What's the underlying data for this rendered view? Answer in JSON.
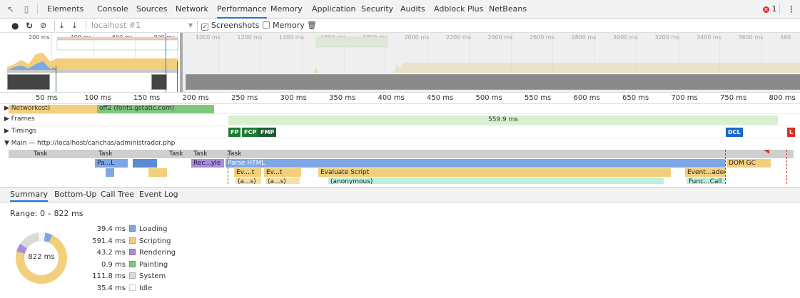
{
  "tabs": [
    "Elements",
    "Console",
    "Sources",
    "Network",
    "Performance",
    "Memory",
    "Application",
    "Security",
    "Audits",
    "Adblock Plus",
    "NetBeans"
  ],
  "active_tab": "Performance",
  "error_count": "1",
  "toolbar": {
    "recording_target": "localhost #1",
    "screenshots_label": "Screenshots",
    "memory_label": "Memory"
  },
  "overview_ticks": [
    "200 ms",
    "400 ms",
    "600 ms",
    "800 ms",
    "1000 ms",
    "1200 ms",
    "1400 ms",
    "1600 ms",
    "1800 ms",
    "2000 ms",
    "2200 ms",
    "2400 ms",
    "2600 ms",
    "2800 ms",
    "3000 ms",
    "3200 ms",
    "3400 ms",
    "3600 ms",
    "380"
  ],
  "ruler_ticks": [
    "50 ms",
    "100 ms",
    "150 ms",
    "200 ms",
    "250 ms",
    "300 ms",
    "350 ms",
    "400 ms",
    "450 ms",
    "500 ms",
    "550 ms",
    "600 ms",
    "650 ms",
    "700 ms",
    "750 ms",
    "800 ms"
  ],
  "tracks": {
    "network": {
      "label": "Network",
      "label_tail": "ost)",
      "request": "off2 (fonts.gstatic.com)"
    },
    "frames": {
      "label": "Frames",
      "frame_time": "559.9 ms"
    },
    "timings": {
      "label": "Timings",
      "fp": "FP",
      "fcp": "FCP",
      "fmp": "FMP",
      "dcl": "DCL",
      "l": "L"
    },
    "main": {
      "label": "Main — http://localhost/canchas/administrador.php"
    }
  },
  "flame": {
    "task": "Task",
    "parse_short": "Pa...L",
    "recalc_style": "Rec...yle",
    "parse_html": "Parse HTML",
    "dom_gc": "DOM GC",
    "ev_short": "Ev....t",
    "ev_short2": "Ev...t",
    "evaluate_script": "Evaluate Script",
    "event_loaded": "Event...aded",
    "anon_short": "(a...s)",
    "anon_short2": "(a...s)",
    "anonymous": "(anonymous)",
    "func_call": "Func...Call"
  },
  "bottom_tabs": [
    "Summary",
    "Bottom-Up",
    "Call Tree",
    "Event Log"
  ],
  "summary": {
    "range": "Range: 0 – 822 ms",
    "total": "822 ms",
    "items": [
      {
        "value": "39.4 ms",
        "name": "Loading",
        "color": "#7ea7e8",
        "ms": 39.4
      },
      {
        "value": "591.4 ms",
        "name": "Scripting",
        "color": "#f2cf7b",
        "ms": 591.4
      },
      {
        "value": "43.2 ms",
        "name": "Rendering",
        "color": "#a98ce0",
        "ms": 43.2
      },
      {
        "value": "0.9 ms",
        "name": "Painting",
        "color": "#7fc77f",
        "ms": 0.9
      },
      {
        "value": "111.8 ms",
        "name": "System",
        "color": "#dadada",
        "ms": 111.8
      },
      {
        "value": "35.4 ms",
        "name": "Idle",
        "color": "#ffffff",
        "ms": 35.4
      }
    ]
  }
}
